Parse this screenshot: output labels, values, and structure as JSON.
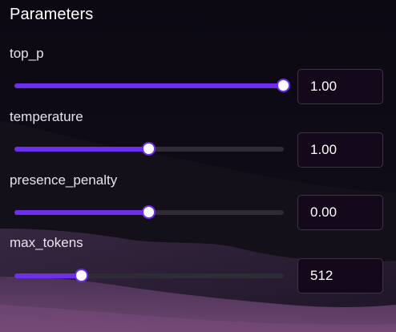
{
  "panel": {
    "title": "Parameters"
  },
  "params": [
    {
      "label": "top_p",
      "value": "1.00",
      "level": 1.0
    },
    {
      "label": "temperature",
      "value": "1.00",
      "level": 0.5
    },
    {
      "label": "presence_penalty",
      "value": "0.00",
      "level": 0.5
    },
    {
      "label": "max_tokens",
      "value": "512",
      "level": 0.25
    }
  ],
  "colors": {
    "accent": "#6d2ef0",
    "track": "#2f2c36",
    "background": "#0c0913",
    "input_background": "#13091a",
    "input_border": "#3a3545"
  }
}
